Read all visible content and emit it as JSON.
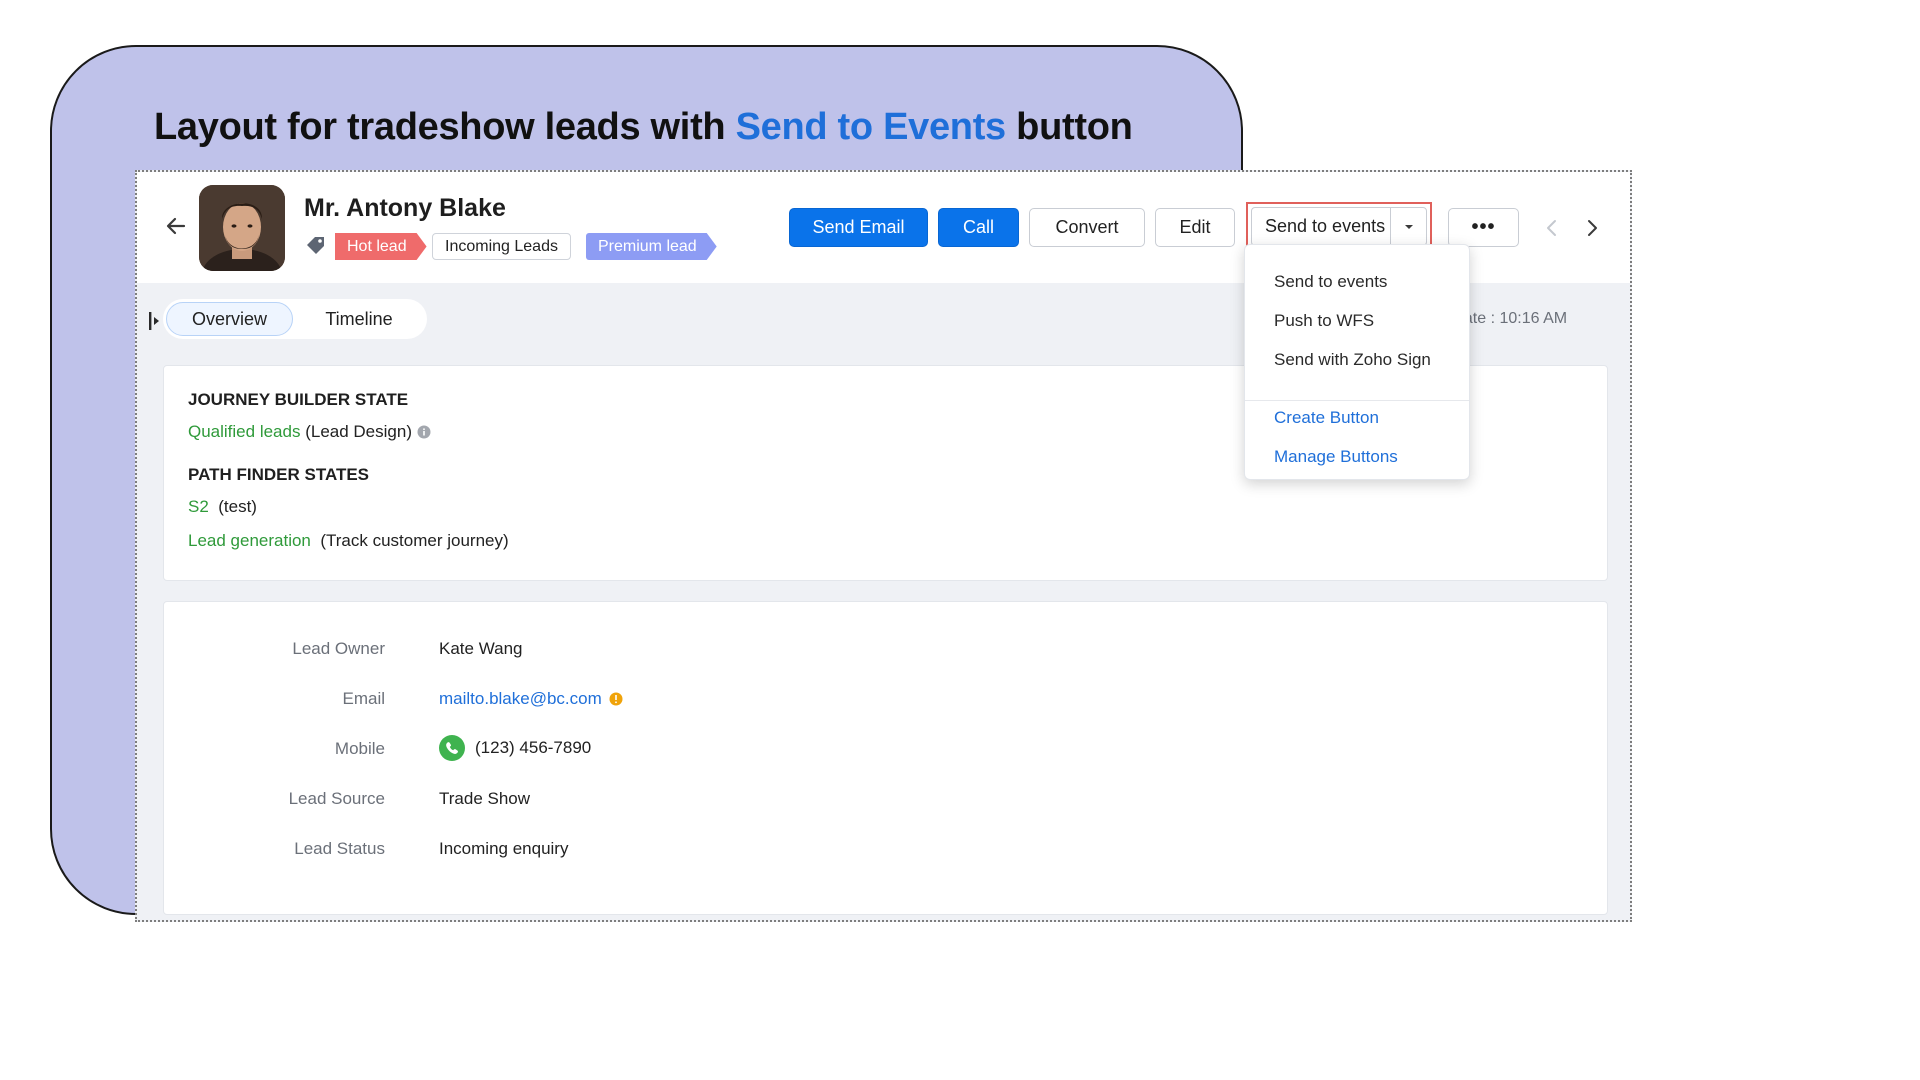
{
  "headline": {
    "prefix": "Layout for tradeshow leads with ",
    "accent": "Send to Events",
    "suffix": " button"
  },
  "record": {
    "name": "Mr. Antony Blake",
    "tags": [
      "Hot lead",
      "Incoming Leads",
      "Premium lead"
    ]
  },
  "toolbar": {
    "send_email": "Send Email",
    "call": "Call",
    "convert": "Convert",
    "edit": "Edit",
    "send_to_events": "Send to events",
    "more": "•••"
  },
  "dropdown": {
    "items": [
      "Send to events",
      "Push to WFS",
      "Send with Zoho Sign"
    ],
    "links": [
      "Create Button",
      "Manage Buttons"
    ]
  },
  "tabs": {
    "overview": "Overview",
    "timeline": "Timeline"
  },
  "last_update": "date : 10:16 AM",
  "journey": {
    "title": "JOURNEY BUILDER STATE",
    "state": "Qualified leads",
    "detail": "(Lead Design)"
  },
  "path_finder": {
    "title": "PATH FINDER STATES",
    "states": [
      {
        "name": "S2",
        "detail": "(test)"
      },
      {
        "name": "Lead generation",
        "detail": "(Track customer journey)"
      }
    ]
  },
  "fields": [
    {
      "label": "Lead Owner",
      "value": "Kate Wang"
    },
    {
      "label": "Email",
      "value": "mailto.blake@bc.com"
    },
    {
      "label": "Mobile",
      "value": "(123) 456-7890"
    },
    {
      "label": "Lead Source",
      "value": "Trade Show"
    },
    {
      "label": "Lead Status",
      "value": "Incoming enquiry"
    }
  ],
  "colors": {
    "background_card": "#bfc2ea",
    "primary_button": "#0a73ea",
    "accent_text": "#1f6fd9",
    "hot_lead": "#ef6b6b",
    "premium_lead": "#8d9cf4",
    "state_green": "#2f9a3a",
    "highlight_border": "#e0605b"
  }
}
